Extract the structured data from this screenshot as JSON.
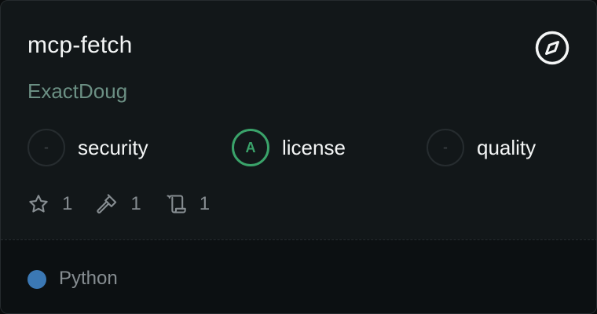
{
  "card": {
    "title": "mcp-fetch",
    "author": "ExactDoug",
    "header_icon": "compass-icon"
  },
  "scores": [
    {
      "grade": "-",
      "label": "security",
      "graded": false
    },
    {
      "grade": "A",
      "label": "license",
      "graded": true,
      "color": "#3aa36a"
    },
    {
      "grade": "-",
      "label": "quality",
      "graded": false
    }
  ],
  "stats": [
    {
      "icon": "star-icon",
      "count": "1"
    },
    {
      "icon": "hammer-icon",
      "count": "1"
    },
    {
      "icon": "scroll-icon",
      "count": "1"
    }
  ],
  "footer": {
    "language": "Python",
    "language_color": "#3b78b4"
  }
}
